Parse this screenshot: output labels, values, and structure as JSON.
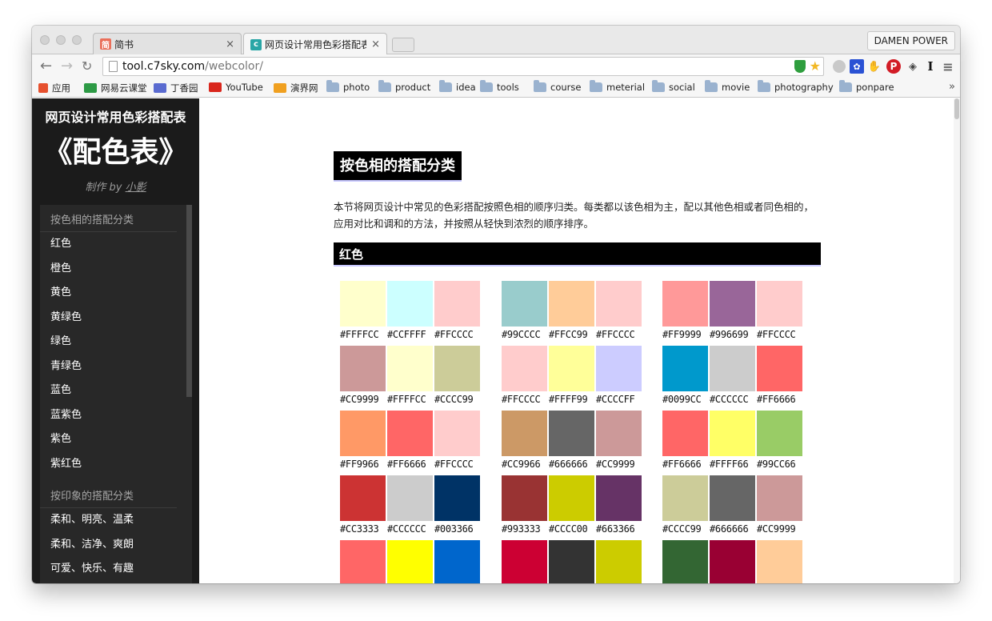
{
  "browser": {
    "tabs": [
      {
        "title": "简书",
        "favicon": "jianshu-favicon",
        "favicon_text": "简",
        "active": false
      },
      {
        "title": "网页设计常用色彩搭配表 - 酷",
        "favicon": "c7sky-favicon",
        "active": true
      }
    ],
    "profile": "DAMEN POWER",
    "url_domain": "tool.c7sky.com",
    "url_path": "/webcolor/",
    "bookmarks": [
      {
        "label": "应用",
        "icon": "apps-grid-icon"
      },
      {
        "label": "网易云课堂",
        "icon": "netease-study-icon"
      },
      {
        "label": "丁香园",
        "icon": "dxy-icon"
      },
      {
        "label": "YouTube",
        "icon": "youtube-icon"
      },
      {
        "label": "演界网",
        "icon": "yanjie-icon"
      },
      {
        "label": "photo",
        "icon": "folder-icon"
      },
      {
        "label": "product",
        "icon": "folder-icon"
      },
      {
        "label": "idea",
        "icon": "folder-icon"
      },
      {
        "label": "tools",
        "icon": "folder-icon"
      },
      {
        "label": "course",
        "icon": "folder-icon"
      },
      {
        "label": "meterial",
        "icon": "folder-icon"
      },
      {
        "label": "social",
        "icon": "folder-icon"
      },
      {
        "label": "movie",
        "icon": "folder-icon"
      },
      {
        "label": "photography",
        "icon": "folder-icon"
      },
      {
        "label": "ponpare",
        "icon": "folder-icon"
      }
    ],
    "bookmarks_more": "»",
    "ext_text": "I"
  },
  "sidebar": {
    "site_title": "网页设计常用色彩搭配表",
    "logo": "《配色表》",
    "author_prefix": "制作 by",
    "author_name": "小影",
    "sections": [
      {
        "heading": "按色相的搭配分类",
        "items": [
          "红色",
          "橙色",
          "黄色",
          "黄绿色",
          "绿色",
          "青绿色",
          "蓝色",
          "蓝紫色",
          "紫色",
          "紫红色"
        ]
      },
      {
        "heading": "按印象的搭配分类",
        "items": [
          "柔和、明亮、温柔",
          "柔和、洁净、爽朗",
          "可爱、快乐、有趣"
        ]
      }
    ]
  },
  "main": {
    "section_title": "按色相的搭配分类",
    "intro": "本节将网页设计中常见的色彩搭配按照色相的顺序归类。每类都以该色相为主，配以其他色相或者同色相的，应用对比和调和的方法，并按照从轻快到浓烈的顺序排序。",
    "color_heading": "红色",
    "palettes": [
      [
        [
          "#FFFFCC",
          "#CCFFFF",
          "#FFCCCC"
        ],
        [
          "#CC9999",
          "#FFFFCC",
          "#CCCC99"
        ],
        [
          "#FF9966",
          "#FF6666",
          "#FFCCCC"
        ],
        [
          "#CC3333",
          "#CCCCCC",
          "#003366"
        ],
        [
          "#FF6666",
          "#FFFF00",
          "#0066CC"
        ]
      ],
      [
        [
          "#99CCCC",
          "#FFCC99",
          "#FFCCCC"
        ],
        [
          "#FFCCCC",
          "#FFFF99",
          "#CCCCFF"
        ],
        [
          "#CC9966",
          "#666666",
          "#CC9999"
        ],
        [
          "#993333",
          "#CCCC00",
          "#663366"
        ],
        [
          "#CC0033",
          "#333333",
          "#CCCC00"
        ]
      ],
      [
        [
          "#FF9999",
          "#996699",
          "#FFCCCC"
        ],
        [
          "#0099CC",
          "#CCCCCC",
          "#FF6666"
        ],
        [
          "#FF6666",
          "#FFFF66",
          "#99CC66"
        ],
        [
          "#CCCC99",
          "#666666",
          "#CC9999"
        ],
        [
          "#336633",
          "#990033",
          "#FFCC99"
        ]
      ]
    ]
  }
}
